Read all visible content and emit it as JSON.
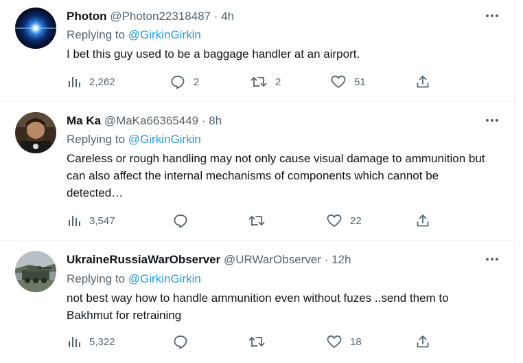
{
  "tweets": [
    {
      "name": "Photon",
      "handle": "@Photon22318487",
      "separator": "·",
      "time": "4h",
      "replying_prefix": "Replying to",
      "replying_to": "@GirkinGirkin",
      "text": "I bet this guy used to be a baggage handler at an airport.",
      "views": "2,262",
      "replies": "2",
      "retweets": "2",
      "likes": "51"
    },
    {
      "name": "Ma Ka",
      "handle": "@MaKa66365449",
      "separator": "·",
      "time": "8h",
      "replying_prefix": "Replying to",
      "replying_to": "@GirkinGirkin",
      "text": "Careless or rough handling may not only cause visual damage to ammunition but can also affect the internal mechanisms of components which cannot be detected…",
      "views": "3,547",
      "replies": "",
      "retweets": "",
      "likes": "22"
    },
    {
      "name": "UkraineRussiaWarObserver",
      "handle": "@URWarObserver",
      "separator": "·",
      "time": "12h",
      "replying_prefix": "Replying to",
      "replying_to": "@GirkinGirkin",
      "text": "not best way how to handle ammunition even without fuzes ..send them to Bakhmut for retraining",
      "views": "5,322",
      "replies": "",
      "retweets": "",
      "likes": "18"
    }
  ],
  "icons": {
    "views": "bar-chart-icon",
    "reply": "speech-bubble-icon",
    "retweet": "retweet-arrows-icon",
    "like": "heart-icon",
    "share": "share-upload-icon",
    "more": "more-dots-icon"
  },
  "colors": {
    "text": "#0f1419",
    "secondary": "#536471",
    "link": "#1d9bf0",
    "border": "#eff3f4"
  }
}
